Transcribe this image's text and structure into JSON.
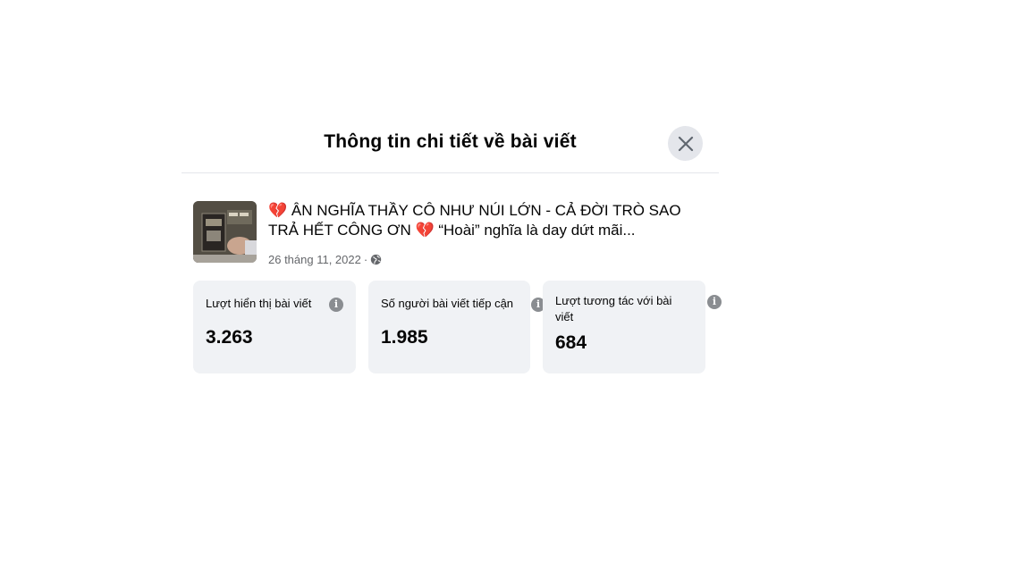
{
  "dialog": {
    "title": "Thông tin chi tiết về bài viết",
    "close_icon": "close-icon"
  },
  "post": {
    "thumbnail_icon": "post-thumbnail-image",
    "text": "💔 ÂN NGHĨA THẦY CÔ NHƯ NÚI LỚN - CẢ ĐỜI TRÒ SAO TRẢ HẾT CÔNG ƠN 💔 “Hoài” nghĩa là day dứt mãi...",
    "date": "26 tháng 11, 2022",
    "separator": "·",
    "audience_icon": "globe-icon"
  },
  "stats": [
    {
      "label": "Lượt hiển thị bài viết",
      "value": "3.263",
      "info_icon": "info-icon"
    },
    {
      "label": "Số người bài viết tiếp cận",
      "value": "1.985",
      "info_icon": "info-icon"
    },
    {
      "label": "Lượt tương tác với bài viết",
      "value": "684",
      "info_icon": "info-icon"
    }
  ],
  "colors": {
    "card_bg": "#f0f2f5",
    "close_bg": "#e4e6eb",
    "muted_text": "#65676b",
    "info_icon": "#8a8d91"
  }
}
